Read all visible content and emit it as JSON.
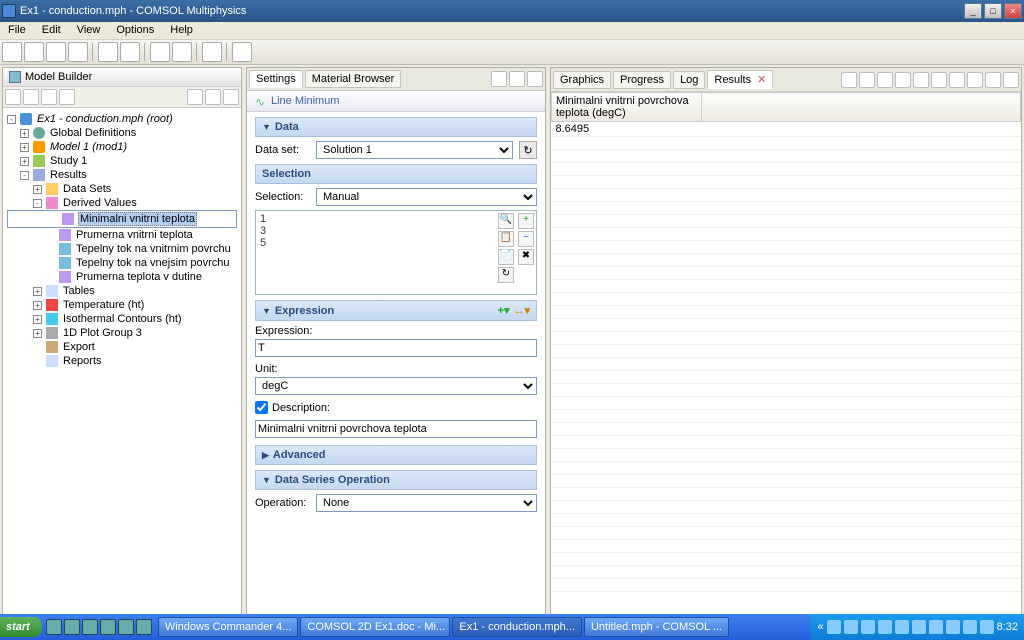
{
  "title": "Ex1 - conduction.mph - COMSOL Multiphysics",
  "menu": [
    "File",
    "Edit",
    "View",
    "Options",
    "Help"
  ],
  "leftPanel": {
    "title": "Model Builder"
  },
  "tree": {
    "root": "Ex1 - conduction.mph (root)",
    "gd": "Global Definitions",
    "model": "Model 1 (mod1)",
    "study": "Study 1",
    "results": "Results",
    "datasets": "Data Sets",
    "derived": "Derived Values",
    "d1": "Minimalni vnitrni teplota",
    "d2": "Prumerna vnitrni teplota",
    "d3": "Tepelny tok na vnitrnim povrchu",
    "d4": "Tepelny tok na vnejsim povrchu",
    "d5": "Prumerna teplota v dutine",
    "tables": "Tables",
    "temp": "Temperature (ht)",
    "iso": "Isothermal Contours (ht)",
    "pg": "1D Plot Group 3",
    "export": "Export",
    "reports": "Reports"
  },
  "settings": {
    "tab1": "Settings",
    "tab2": "Material Browser",
    "header": "Line Minimum",
    "s_data": "Data",
    "s_sel": "Selection",
    "s_expr": "Expression",
    "s_adv": "Advanced",
    "s_dso": "Data Series Operation",
    "dataset_lbl": "Data set:",
    "dataset_val": "Solution 1",
    "selection_lbl": "Selection:",
    "selection_val": "Manual",
    "sel_items": "1\n3\n5",
    "expr_lbl": "Expression:",
    "expr_val": "T",
    "unit_lbl": "Unit:",
    "unit_val": "degC",
    "desc_lbl": "Description:",
    "desc_val": "Minimalni vnitrni povrchova teplota",
    "op_lbl": "Operation:",
    "op_val": "None"
  },
  "right": {
    "t1": "Graphics",
    "t2": "Progress",
    "t3": "Log",
    "t4": "Results",
    "col1": "Minimalni vnitrni povrchova teplota (degC)",
    "val1": "8.6495"
  },
  "taskbar": {
    "start": "start",
    "task1": "Windows Commander 4...",
    "task2": "COMSOL 2D Ex1.doc - Mi...",
    "task3": "Ex1 - conduction.mph...",
    "task4": "Untitled.mph - COMSOL ...",
    "time": "8:32"
  }
}
